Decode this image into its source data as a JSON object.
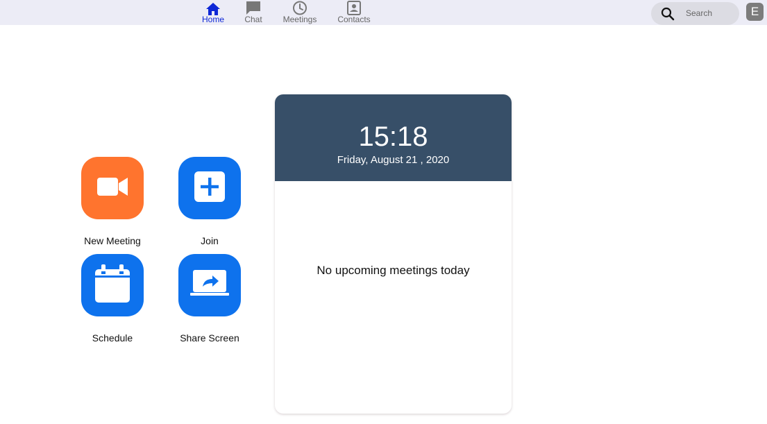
{
  "nav": {
    "items": [
      {
        "label": "Home",
        "icon": "home-icon",
        "active": true
      },
      {
        "label": "Chat",
        "icon": "chat-icon"
      },
      {
        "label": "Meetings",
        "icon": "clock-icon"
      },
      {
        "label": "Contacts",
        "icon": "contacts-icon"
      }
    ]
  },
  "search": {
    "placeholder": "Search",
    "icon": "search-icon"
  },
  "user": {
    "avatar_letter": "E"
  },
  "actions": [
    {
      "label": "New Meeting",
      "icon": "video-camera-icon",
      "color": "#ff742e"
    },
    {
      "label": "Join",
      "icon": "plus-icon",
      "color": "#0e72ed"
    },
    {
      "label": "Schedule",
      "icon": "calendar-icon",
      "color": "#0e72ed"
    },
    {
      "label": "Share Screen",
      "icon": "share-screen-icon",
      "color": "#0e72ed"
    }
  ],
  "card": {
    "time": "15:18",
    "date": "Friday, August 21 , 2020",
    "empty_message": "No upcoming meetings today",
    "header_color": "#374f68"
  }
}
